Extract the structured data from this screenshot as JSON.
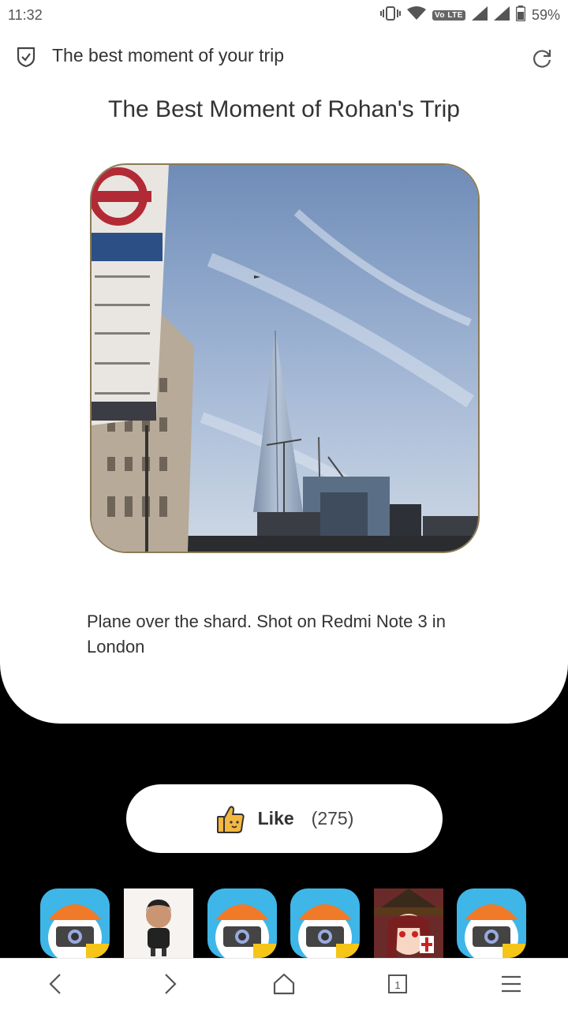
{
  "status_bar": {
    "time": "11:32",
    "network_badge": "Vo LTE",
    "battery": "59%"
  },
  "title_bar": {
    "title": "The best moment of your trip"
  },
  "page": {
    "heading": "The Best Moment of Rohan's Trip",
    "caption": "Plane over the shard. Shot on Redmi Note 3 in London"
  },
  "like": {
    "label": "Like",
    "count": "(275)"
  },
  "avatars": [
    {
      "type": "camera-mascot"
    },
    {
      "type": "person-avatar"
    },
    {
      "type": "camera-mascot"
    },
    {
      "type": "camera-mascot"
    },
    {
      "type": "anime-avatar"
    },
    {
      "type": "camera-mascot"
    }
  ],
  "bottom_nav": {
    "tab_count": "1"
  }
}
